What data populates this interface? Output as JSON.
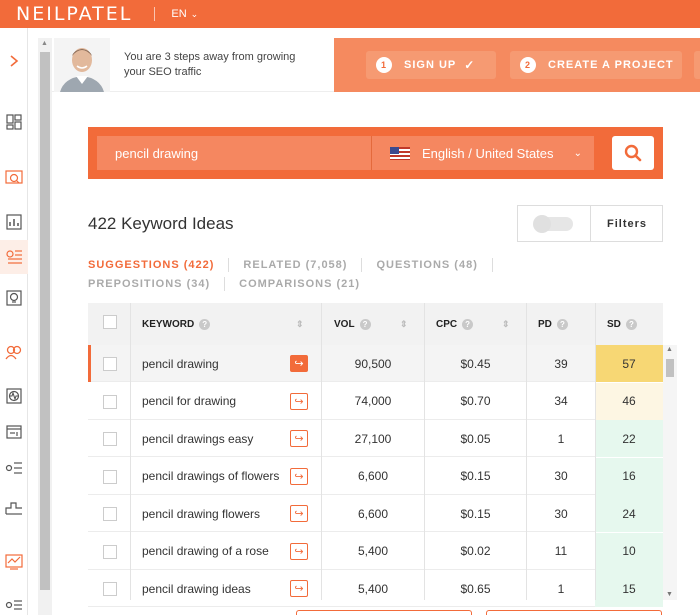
{
  "header": {
    "logo": "NEILPATEL",
    "language": "EN"
  },
  "onboarding": {
    "message": "You are 3 steps away from growing your SEO traffic",
    "steps": [
      {
        "number": "1",
        "label": "SIGN UP"
      },
      {
        "number": "2",
        "label": "CREATE A PROJECT"
      }
    ]
  },
  "search": {
    "query": "pencil drawing",
    "language_location": "English / United States"
  },
  "results": {
    "title": "422 Keyword Ideas",
    "filters_label": "Filters"
  },
  "tabs": [
    {
      "label": "SUGGESTIONS (422)",
      "active": true
    },
    {
      "label": "RELATED (7,058)",
      "active": false
    },
    {
      "label": "QUESTIONS (48)",
      "active": false
    },
    {
      "label": "PREPOSITIONS (34)",
      "active": false
    },
    {
      "label": "COMPARISONS (21)",
      "active": false
    }
  ],
  "table": {
    "headers": {
      "keyword": "KEYWORD",
      "vol": "VOL",
      "cpc": "CPC",
      "pd": "PD",
      "sd": "SD"
    },
    "rows": [
      {
        "keyword": "pencil drawing",
        "vol": "90,500",
        "cpc": "$0.45",
        "pd": "39",
        "sd": "57",
        "sd_color": "#f7d774"
      },
      {
        "keyword": "pencil for drawing",
        "vol": "74,000",
        "cpc": "$0.70",
        "pd": "34",
        "sd": "46",
        "sd_color": "#fdf6e3"
      },
      {
        "keyword": "pencil drawings easy",
        "vol": "27,100",
        "cpc": "$0.05",
        "pd": "1",
        "sd": "22",
        "sd_color": "#e6f8ee"
      },
      {
        "keyword": "pencil drawings of flowers",
        "vol": "6,600",
        "cpc": "$0.15",
        "pd": "30",
        "sd": "16",
        "sd_color": "#e6f8ee"
      },
      {
        "keyword": "pencil drawing flowers",
        "vol": "6,600",
        "cpc": "$0.15",
        "pd": "30",
        "sd": "24",
        "sd_color": "#e6f8ee"
      },
      {
        "keyword": "pencil drawing of a rose",
        "vol": "5,400",
        "cpc": "$0.02",
        "pd": "11",
        "sd": "10",
        "sd_color": "#e6f8ee"
      },
      {
        "keyword": "pencil drawing ideas",
        "vol": "5,400",
        "cpc": "$0.65",
        "pd": "1",
        "sd": "15",
        "sd_color": "#e6f8ee"
      }
    ]
  },
  "colors": {
    "brand": "#f26b3a",
    "brand_light": "#f58760"
  }
}
